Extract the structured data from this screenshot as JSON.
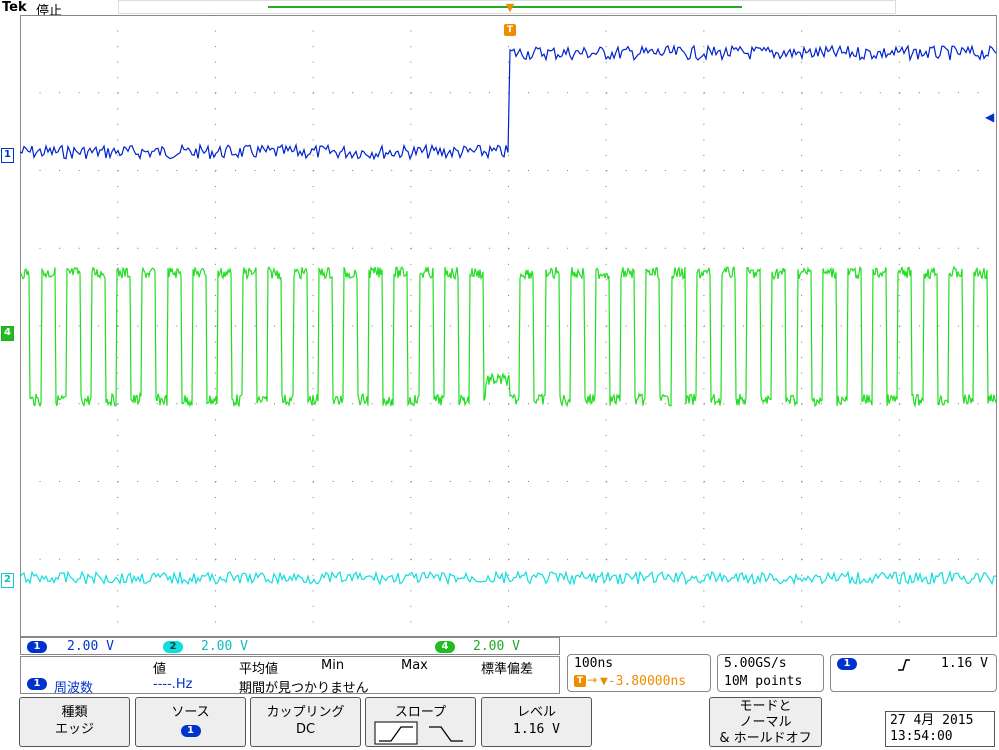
{
  "header": {
    "brand": "Tek",
    "state": "停止"
  },
  "channels": {
    "ch1": {
      "number": "1",
      "scale": "2.00 V",
      "color": "#0033cc"
    },
    "ch2": {
      "number": "2",
      "scale": "2.00 V",
      "color": "#11cccc"
    },
    "ch4": {
      "number": "4",
      "scale": "2.00 V",
      "color": "#22cc22"
    }
  },
  "trigger_marker": "T",
  "measurement": {
    "col_value": "値",
    "col_mean": "平均値",
    "col_min": "Min",
    "col_max": "Max",
    "col_std": "標準偏差",
    "source": "1",
    "name": "周波数",
    "value": "----.Hz",
    "message": "期間が見つかりません"
  },
  "timebase": {
    "scale": "100ns",
    "position": "▼-3.80000ns"
  },
  "acquisition": {
    "sample_rate": "5.00GS/s",
    "record_length": "10M points"
  },
  "trigger": {
    "source": "1",
    "level": "1.16 V",
    "slope_icon": "rising-edge"
  },
  "buttons": {
    "type": {
      "title": "種類",
      "value": "エッジ"
    },
    "source": {
      "title": "ソース",
      "value": "1"
    },
    "coupling": {
      "title": "カップリング",
      "value": "DC"
    },
    "slope": {
      "title": "スロープ"
    },
    "level": {
      "title": "レベル",
      "value": "1.16 V"
    },
    "mode": {
      "line1": "モードと",
      "line2": "ノーマル",
      "line3": "& ホールドオフ"
    }
  },
  "datetime": {
    "date": "27 4月  2015",
    "time": "13:54:00"
  }
}
